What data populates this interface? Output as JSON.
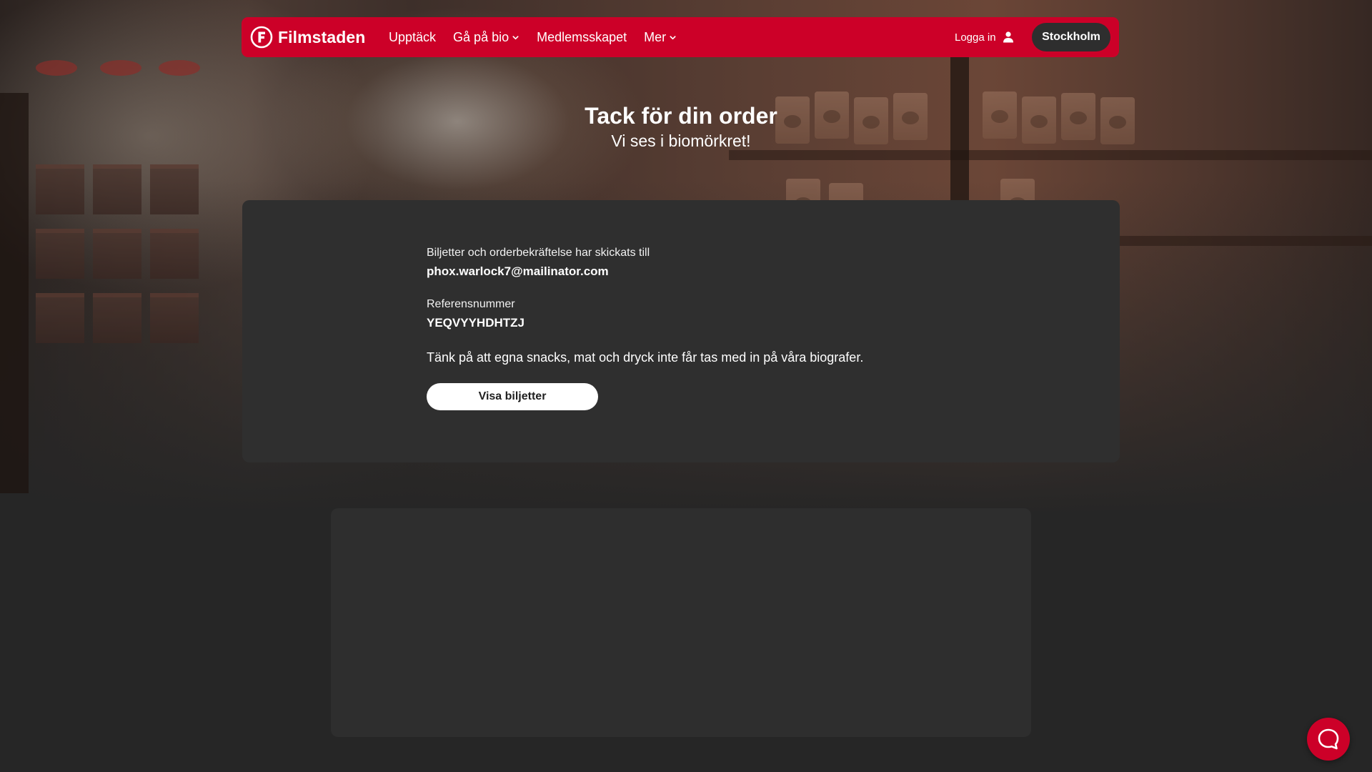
{
  "navbar": {
    "brand_name": "Filmstaden",
    "links": [
      "Upptäck",
      "Gå på bio",
      "Medlemsskapet",
      "Mer"
    ],
    "login_label": "Logga in",
    "city_label": "Stockholm"
  },
  "headline": {
    "title": "Tack för din order",
    "subtitle": "Vi ses i biomörkret!"
  },
  "confirmation": {
    "sent_to_label": "Biljetter och orderbekräftelse har skickats till",
    "email": "phox.warlock7@mailinator.com",
    "reference_label": "Referensnummer",
    "reference_number": "YEQVYYHDHTZJ",
    "snacks_note": "Tänk på att egna snacks, mat och dryck inte får tas med in på våra biografer.",
    "view_tickets_label": "Visa biljetter"
  },
  "colors": {
    "brand_red": "#cc0028",
    "page_background": "#262626",
    "card_background": "#2f2f2f",
    "button_dark": "#2e2e2e"
  },
  "icons": {
    "logo": "filmstaden-f-logo",
    "dropdown": "chevron-down-icon",
    "login": "user-icon",
    "chat": "chat-bubble-icon"
  }
}
